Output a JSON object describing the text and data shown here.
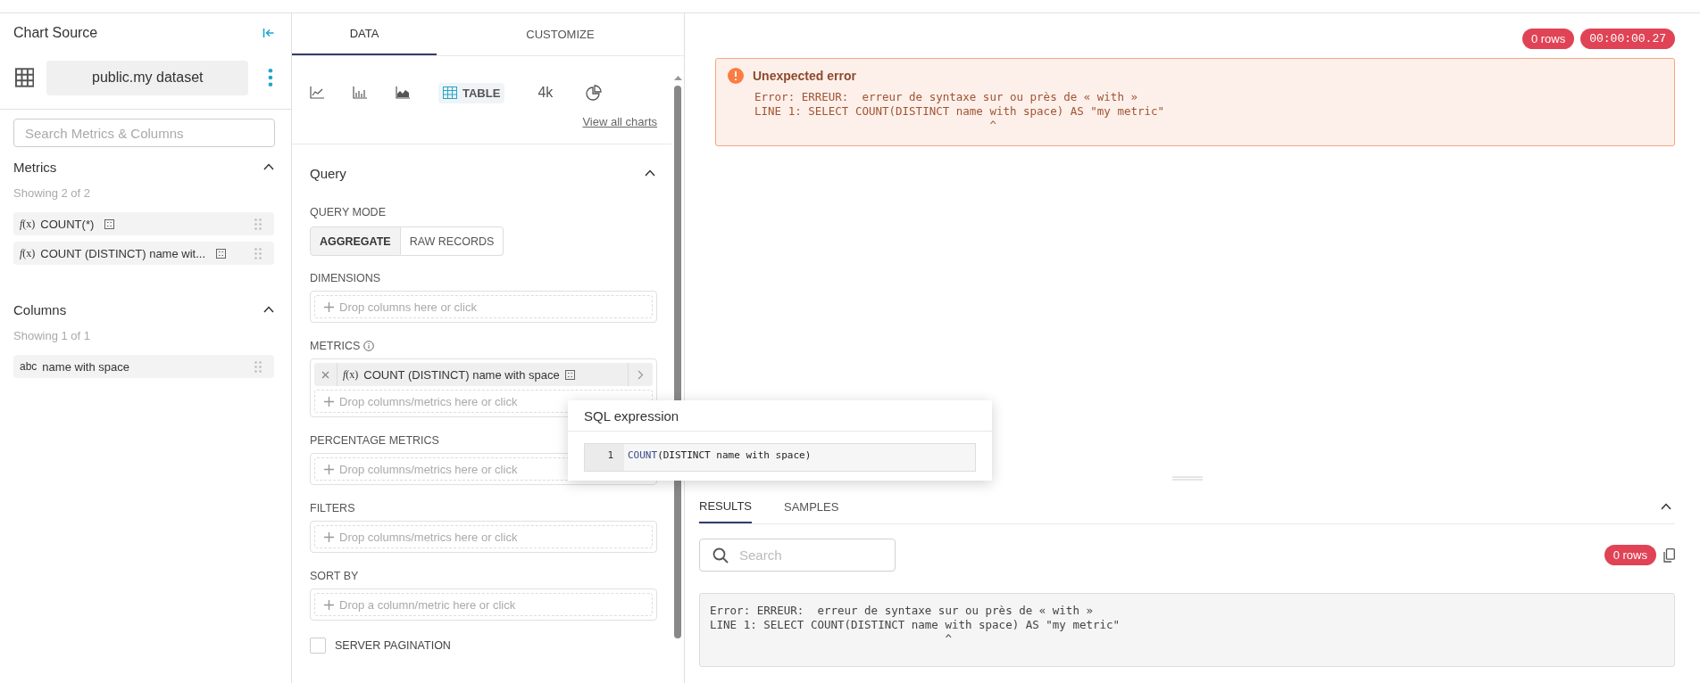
{
  "sidebar": {
    "title": "Chart Source",
    "dataset": "public.my dataset",
    "search": {
      "placeholder": "Search Metrics & Columns"
    },
    "sections": [
      {
        "title": "Metrics",
        "count": "Showing 2 of 2",
        "items": [
          {
            "kind": "metric",
            "type_label": "*f*(x)",
            "label": "COUNT(*)"
          },
          {
            "kind": "metric",
            "type_label": "*f*(x)",
            "label": "COUNT (DISTINCT) name wit..."
          }
        ]
      },
      {
        "title": "Columns",
        "count": "Showing 1 of 1",
        "items": [
          {
            "kind": "column",
            "type_label": "abc",
            "label": "name with space"
          }
        ]
      }
    ]
  },
  "tabs": [
    {
      "label": "DATA",
      "selected": true
    },
    {
      "label": "CUSTOMIZE",
      "selected": false
    }
  ],
  "chart_types": [
    {
      "kind": "line",
      "selected": false
    },
    {
      "kind": "bar",
      "selected": false
    },
    {
      "kind": "area",
      "selected": false
    },
    {
      "kind": "table",
      "label": "TABLE",
      "selected": true
    },
    {
      "kind": "big_number",
      "label": "4k",
      "selected": false
    },
    {
      "kind": "pie",
      "selected": false
    }
  ],
  "view_all": "View all charts",
  "query": {
    "title": "Query",
    "mode_label": "QUERY MODE",
    "modes": [
      {
        "label": "AGGREGATE",
        "selected": true
      },
      {
        "label": "RAW RECORDS",
        "selected": false
      }
    ],
    "controls": [
      {
        "label": "DIMENSIONS",
        "info": false,
        "placeholder": "Drop columns here or click"
      },
      {
        "label": "METRICS",
        "info": true,
        "values": [
          {
            "type_label": "*f*(x)",
            "label": "COUNT (DISTINCT) name with space"
          }
        ],
        "placeholder": "Drop columns/metrics here or click"
      },
      {
        "label": "PERCENTAGE METRICS",
        "info": false,
        "placeholder": "Drop columns/metrics here or click"
      },
      {
        "label": "FILTERS",
        "info": false,
        "placeholder": "Drop columns/metrics here or click"
      },
      {
        "label": "SORT BY",
        "info": false,
        "placeholder": "Drop a column/metric here or click"
      }
    ],
    "server_pagination": {
      "label": "SERVER PAGINATION",
      "checked": false
    }
  },
  "popover": {
    "title": "SQL expression",
    "line": "1",
    "code": [
      {
        "kind": "keyword",
        "text": "COUNT"
      },
      {
        "kind": "plain",
        "text": "(DISTINCT name with space)"
      }
    ]
  },
  "badges": [
    {
      "kind": "text",
      "label": "0 rows"
    },
    {
      "kind": "mono",
      "label": "00:00:00.27"
    }
  ],
  "error": {
    "title": "Unexpected error",
    "lines": [
      "Error: ERREUR:  erreur de syntaxe sur ou près de « with »",
      "LINE 1: SELECT COUNT(DISTINCT name with space) AS \"my metric\"",
      "                                   ^"
    ]
  },
  "results": {
    "tabs": [
      {
        "label": "RESULTS",
        "selected": true
      },
      {
        "label": "SAMPLES",
        "selected": false
      }
    ],
    "search": {
      "placeholder": "Search"
    },
    "rows_badge": "0 rows",
    "lines": [
      "Error: ERREUR:  erreur de syntaxe sur ou près de « with »",
      "LINE 1: SELECT COUNT(DISTINCT name with space) AS \"my metric\"",
      "                                   ^"
    ]
  }
}
